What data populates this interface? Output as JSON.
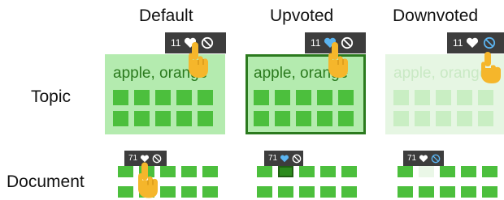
{
  "columns": {
    "default": "Default",
    "upvoted": "Upvoted",
    "downvoted": "Downvoted"
  },
  "rows": {
    "topic": "Topic",
    "document": "Document"
  },
  "topic_card": {
    "keywords": "apple, orange"
  },
  "vote_counts": {
    "topic": "11",
    "document": "71"
  },
  "colors": {
    "topic_fill": "#b4ebaf",
    "topic_fill_downvoted": "#e6f6e3",
    "topic_border_upvoted": "#2b7a1e",
    "cell_green": "#4cbf3d",
    "heart_default": "#ffffff",
    "heart_upvoted": "#5bb4f0",
    "ban_downvoted": "#5bb4f0",
    "hand": "#f5b62b"
  },
  "icons": [
    "heart-icon",
    "ban-icon",
    "pointing-hand-icon"
  ]
}
